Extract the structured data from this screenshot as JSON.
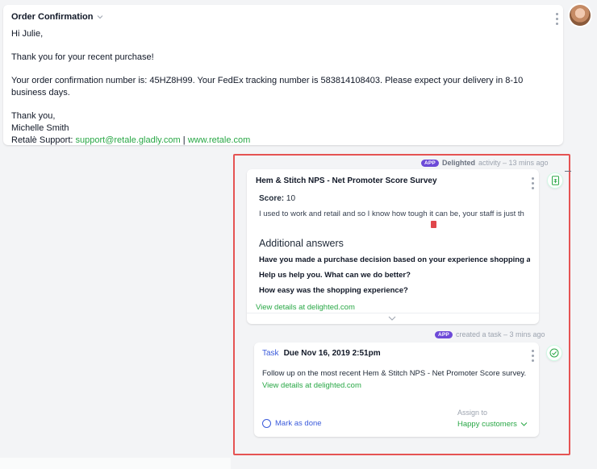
{
  "email": {
    "title": "Order Confirmation",
    "greeting": "Hi Julie,",
    "line1": "Thank you for your recent purchase!",
    "line2": "Your order confirmation number is: 45HZ8H99. Your FedEx tracking number is 583814108403. Please expect your delivery in 8-10 business days.",
    "signoff": "Thank you,",
    "name": "Michelle Smith",
    "support_prefix": "Retalè Support: ",
    "support_email": "support@retale.gladly.com",
    "separator": " | ",
    "website": "www.retale.com"
  },
  "survey_meta": {
    "badge": "APP",
    "source": "Delighted",
    "text": "activity – 13 mins ago"
  },
  "survey": {
    "title": "Hem & Stitch NPS - Net Promoter Score Survey",
    "score_label": "Score:",
    "score_value": "10",
    "comment": "I used to work and retail and so I know how tough it can be, your staff is just th",
    "subtitle": "Additional answers",
    "questions": [
      "Have you made a purchase decision based on your experience shopping at I",
      "Help us help you. What can we do better?",
      "How easy was the shopping experience?"
    ],
    "link": "View details at delighted.com"
  },
  "task_meta": {
    "badge": "APP",
    "text": "created a task – 3 mins ago"
  },
  "task": {
    "label": "Task",
    "due": "Due Nov 16, 2019 2:51pm",
    "body": "Follow up on the most recent Hem & Stitch NPS - Net Promoter Score survey.",
    "link": "View details at delighted.com",
    "mark_done": "Mark as done",
    "assign_label": "Assign to",
    "assign_value": "Happy customers"
  },
  "colors": {
    "link_green": "#28a745",
    "accent_blue": "#3b5bdb",
    "app_badge": "#6d4ad8",
    "highlight_red": "#e55353"
  }
}
